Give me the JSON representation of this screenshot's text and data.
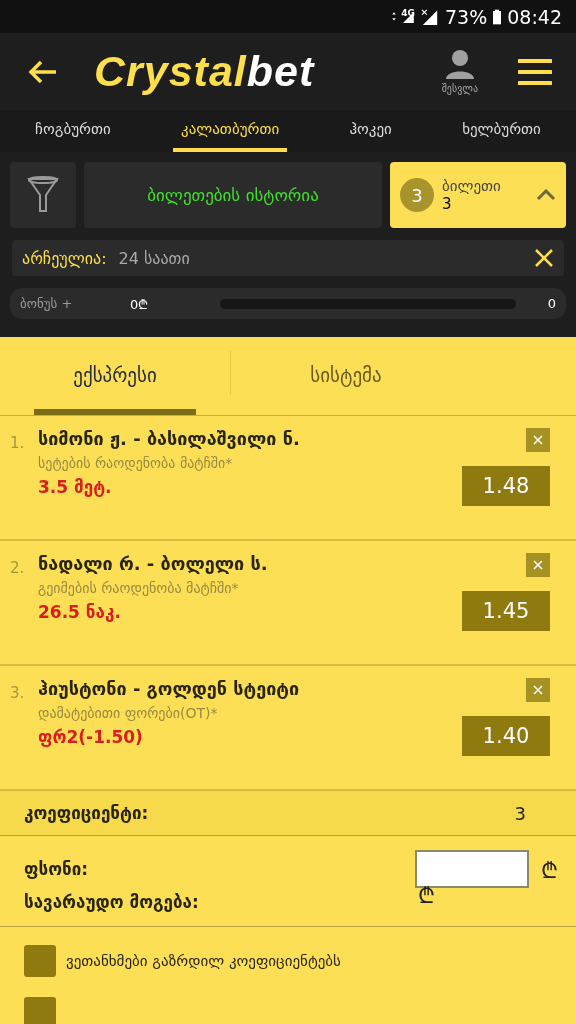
{
  "status_bar": {
    "network": "4G",
    "battery": "73%",
    "time": "08:42"
  },
  "header": {
    "logo": {
      "part1": "Crystal",
      "part2": "bet"
    },
    "login_label": "შესვლა"
  },
  "sport_tabs": [
    {
      "label": "ჩოგბურთი",
      "selected": false
    },
    {
      "label": "კალათბურთი",
      "selected": true
    },
    {
      "label": "ჰოკეი",
      "selected": false
    },
    {
      "label": "ხელბურთი",
      "selected": false
    }
  ],
  "history_button": "ბილეთების ისტორია",
  "ticket": {
    "count": "3",
    "label": "ბილეთი",
    "value": "3",
    "expanded": true
  },
  "filter": {
    "label": "არჩეულია:",
    "value": "24 საათი"
  },
  "bonus": {
    "label": "ბონუს +",
    "amount": "0₾",
    "level": 0,
    "value": "0"
  },
  "bet_tabs": [
    {
      "label": "ექსპრესი",
      "selected": true
    },
    {
      "label": "სისტემა",
      "selected": false
    }
  ],
  "bets": [
    {
      "number": "1.",
      "match": "სიმონი ჟ. - ბასილაშვილი ნ.",
      "market": "სეტების რაოდენობა მატჩში*",
      "pick": "3.5 მეტ.",
      "odds": "1.48"
    },
    {
      "number": "2.",
      "match": "ნადალი რ. - ბოლელი ს.",
      "market": "გეიმების რაოდენობა მატჩში*",
      "pick": "26.5 ნაკ.",
      "odds": "1.45"
    },
    {
      "number": "3.",
      "match": "ჰიუსტონი - გოლდენ სტეიტი",
      "market": "დამატებითი ფორები(OT)*",
      "pick": "ფრ2(-1.50)",
      "odds": "1.40"
    }
  ],
  "coefficient": {
    "label": "კოეფიციენტი:",
    "value": "3"
  },
  "stake": {
    "label": "ფსონი:",
    "currency": "₾"
  },
  "possible_win": {
    "label": "სავარაუდო მოგება:",
    "currency": "₾"
  },
  "checkboxes": [
    {
      "label": "ვეთანხმები გაზრდილ კოეფიციენტებს",
      "checked": false
    },
    {
      "checked": false
    }
  ]
}
